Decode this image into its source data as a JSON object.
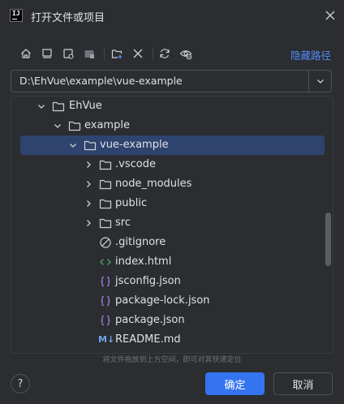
{
  "window": {
    "title": "打开文件或项目",
    "app_icon_text": "IJ"
  },
  "toolbar": {
    "buttons": [
      {
        "name": "home-icon"
      },
      {
        "name": "desktop-icon"
      },
      {
        "name": "project-folder-icon"
      },
      {
        "name": "module-folder-icon"
      },
      {
        "name": "new-folder-icon"
      },
      {
        "name": "delete-icon"
      },
      {
        "name": "refresh-icon"
      },
      {
        "name": "show-hidden-icon"
      }
    ],
    "hide_path_label": "隐藏路径"
  },
  "path_field": {
    "value": "D:\\EhVue\\example\\vue-example"
  },
  "tree": {
    "rows": [
      {
        "label": "EhVue",
        "type": "folder",
        "expanded": true
      },
      {
        "label": "example",
        "type": "folder",
        "expanded": true
      },
      {
        "label": "vue-example",
        "type": "folder",
        "expanded": true,
        "selected": true
      },
      {
        "label": ".vscode",
        "type": "folder",
        "expanded": false
      },
      {
        "label": "node_modules",
        "type": "folder",
        "expanded": false
      },
      {
        "label": "public",
        "type": "folder",
        "expanded": false
      },
      {
        "label": "src",
        "type": "folder",
        "expanded": false
      },
      {
        "label": ".gitignore",
        "type": "ignore"
      },
      {
        "label": "index.html",
        "type": "html"
      },
      {
        "label": "jsconfig.json",
        "type": "json"
      },
      {
        "label": "package-lock.json",
        "type": "json"
      },
      {
        "label": "package.json",
        "type": "json"
      },
      {
        "label": "README.md",
        "type": "markdown",
        "icon_text": "M↓"
      }
    ]
  },
  "hint": "将文件拖放到上方空间，即可对其快速定位",
  "footer": {
    "help_label": "?",
    "ok_label": "确定",
    "cancel_label": "取消"
  },
  "colors": {
    "background": "#2b2d30",
    "accent": "#3574f0",
    "link": "#548af7",
    "selection": "#2e436e",
    "html_icon": "#4c9a5f",
    "json_icon": "#9f7ae0",
    "markdown_icon": "#6ea6e8"
  }
}
